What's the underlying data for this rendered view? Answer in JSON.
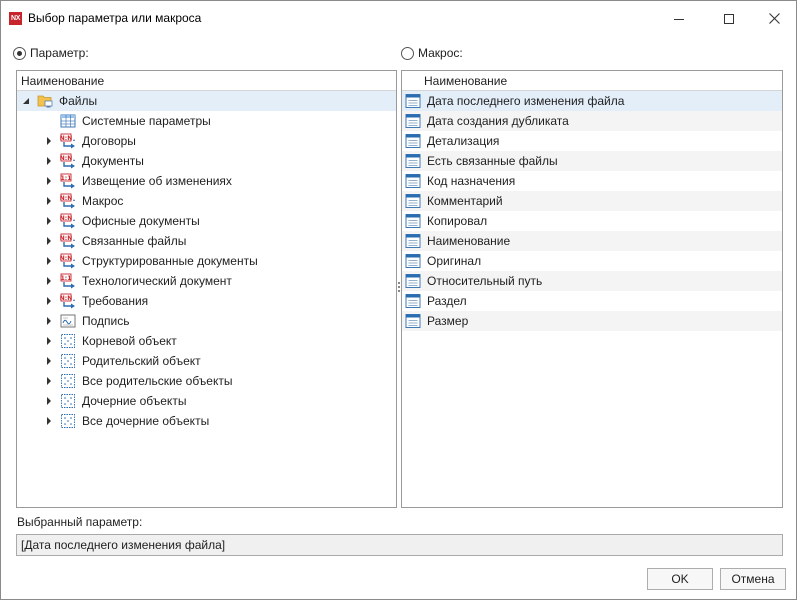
{
  "window": {
    "title": "Выбор параметра или макроса",
    "logo_text": "NX"
  },
  "mode": {
    "param_label": "Параметр:",
    "macro_label": "Макрос:",
    "selected": "param"
  },
  "left_panel": {
    "header": "Наименование",
    "root": {
      "label": "Файлы",
      "expanded": true,
      "icon": "folder-icon"
    },
    "items": [
      {
        "label": "Системные параметры",
        "icon": "table-icon",
        "expandable": false
      },
      {
        "label": "Договоры",
        "icon": "link-nn-icon",
        "expandable": true
      },
      {
        "label": "Документы",
        "icon": "link-nn-icon",
        "expandable": true
      },
      {
        "label": "Извещение об изменениях",
        "icon": "link-11-icon",
        "expandable": true
      },
      {
        "label": "Макрос",
        "icon": "link-nn-icon",
        "expandable": true
      },
      {
        "label": "Офисные документы",
        "icon": "link-nn-icon",
        "expandable": true
      },
      {
        "label": "Связанные файлы",
        "icon": "link-nn-icon",
        "expandable": true
      },
      {
        "label": "Структурированные документы",
        "icon": "link-nn-icon",
        "expandable": true
      },
      {
        "label": "Технологический документ",
        "icon": "link-11-icon",
        "expandable": true
      },
      {
        "label": "Требования",
        "icon": "link-nn-icon",
        "expandable": true
      },
      {
        "label": "Подпись",
        "icon": "signature-icon",
        "expandable": true
      },
      {
        "label": "Корневой объект",
        "icon": "object-icon",
        "expandable": true
      },
      {
        "label": "Родительский объект",
        "icon": "object-icon",
        "expandable": true
      },
      {
        "label": "Все родительские объекты",
        "icon": "object-icon",
        "expandable": true
      },
      {
        "label": "Дочерние объекты",
        "icon": "object-icon",
        "expandable": true
      },
      {
        "label": "Все дочерние объекты",
        "icon": "object-icon",
        "expandable": true
      }
    ]
  },
  "right_panel": {
    "header": "Наименование",
    "items": [
      {
        "label": "Дата последнего изменения файла"
      },
      {
        "label": "Дата создания дубликата"
      },
      {
        "label": "Детализация"
      },
      {
        "label": "Есть связанные файлы"
      },
      {
        "label": "Код назначения"
      },
      {
        "label": "Комментарий"
      },
      {
        "label": "Копировал"
      },
      {
        "label": "Наименование"
      },
      {
        "label": "Оригинал"
      },
      {
        "label": "Относительный путь"
      },
      {
        "label": "Раздел"
      },
      {
        "label": "Размер"
      }
    ],
    "selected_index": 0
  },
  "selected_param": {
    "label": "Выбранный параметр:",
    "value": "[Дата последнего изменения файла]"
  },
  "buttons": {
    "ok": "OK",
    "cancel": "Отмена"
  },
  "colors": {
    "accent": "#c8242c",
    "selection": "#e3eef9",
    "icon_blue": "#2b6cb0"
  }
}
